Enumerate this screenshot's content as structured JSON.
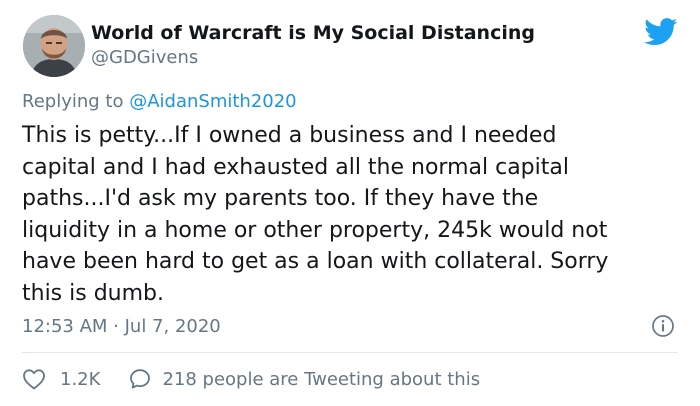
{
  "author": {
    "display_name": "World of Warcraft is My Social Distancing",
    "handle": "@GDGivens"
  },
  "reply": {
    "prefix": "Replying to",
    "mention": "@AidanSmith2020"
  },
  "body": "This is petty...If I owned a business and I needed\ncapital and I had exhausted all the normal capital\npaths...I'd ask my parents too. If they have the\nliquidity in a home or other property, 245k would not\nhave been hard to get as a loan with collateral. Sorry\nthis is dumb.",
  "timestamp": "12:53 AM · Jul 7, 2020",
  "stats": {
    "likes": "1.2K",
    "conversation": "218 people are Tweeting about this"
  },
  "icons": {
    "brand": "twitter-bird-icon",
    "info": "info-icon",
    "like": "heart-icon",
    "reply": "speech-bubble-icon"
  },
  "colors": {
    "brand": "#1da1f2",
    "secondary_text": "#657786",
    "mention": "#1b95e0",
    "divider": "#e1e8ed"
  }
}
